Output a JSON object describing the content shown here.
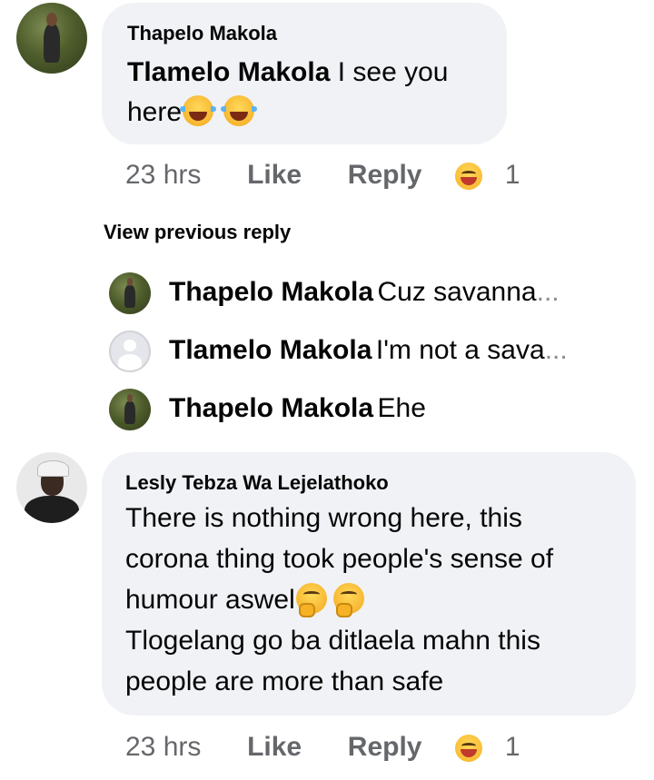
{
  "comment1": {
    "author": "Thapelo Makola",
    "mention": "Tlamelo Makola",
    "text_line1": "I see you",
    "text_line2": "here",
    "emojis": [
      "laughing-tears-emoji",
      "laughing-tears-emoji"
    ],
    "time": "23 hrs",
    "like_label": "Like",
    "reply_label": "Reply",
    "reaction_icon": "laugh-reaction-icon",
    "reaction_count": "1"
  },
  "view_previous": "View previous reply",
  "replies": [
    {
      "name": "Thapelo Makola",
      "snippet": "Cuz savanna",
      "ellipsis": "...",
      "avatar": "photo"
    },
    {
      "name": "Tlamelo Makola",
      "snippet": "I'm not a sava",
      "ellipsis": "...",
      "avatar": "blank"
    },
    {
      "name": "Thapelo Makola",
      "snippet": "Ehe",
      "ellipsis": "",
      "avatar": "photo"
    }
  ],
  "comment2": {
    "author": "Lesly Tebza Wa Lejelathoko",
    "lines": [
      "There is nothing wrong here, this",
      "corona thing took people's sense of",
      "humour aswel",
      "Tlogelang go ba ditlaela mahn this",
      "people are more than safe"
    ],
    "emojis": [
      "thinking-emoji",
      "thinking-emoji"
    ],
    "time": "23 hrs",
    "like_label": "Like",
    "reply_label": "Reply",
    "reaction_icon": "laugh-reaction-icon",
    "reaction_count": "1"
  }
}
